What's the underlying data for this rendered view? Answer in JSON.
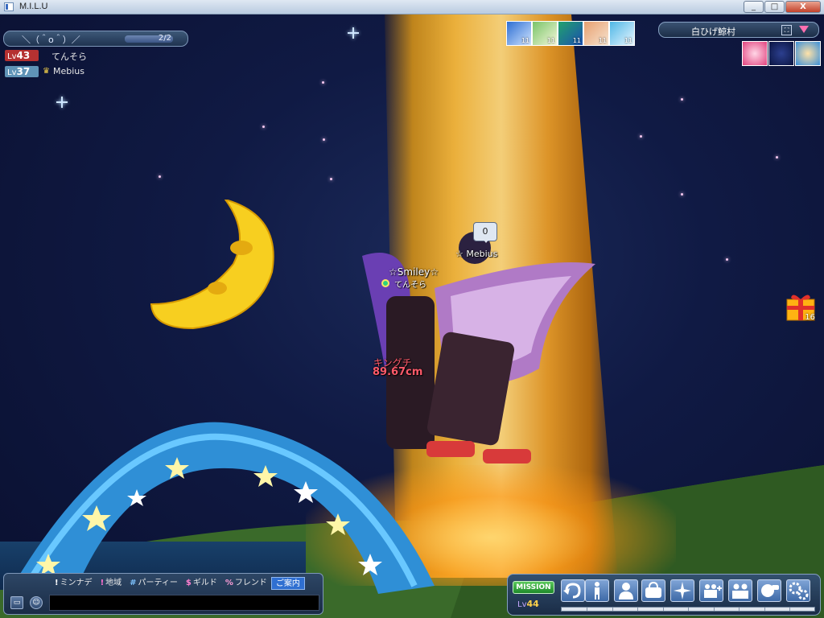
{
  "window": {
    "title": "M.I.L.U",
    "minimize": "_",
    "maximize": "□",
    "close": "X"
  },
  "party": {
    "emote": "＼（＾o＾）／",
    "count": "2/2",
    "members": [
      {
        "level_prefix": "Lv",
        "level": "43",
        "name": "てんそら",
        "color": "#b53131"
      },
      {
        "level_prefix": "Lv",
        "level": "37",
        "name": "Mebius",
        "color": "#5f93b7",
        "leader": true
      }
    ]
  },
  "location": {
    "name": "白ひげ鯨村"
  },
  "buffs": [
    {
      "icon": "eye-buff-icon",
      "timer": "11"
    },
    {
      "icon": "leaf-buff-icon",
      "timer": "11"
    },
    {
      "icon": "wave-buff-icon",
      "timer": "11"
    },
    {
      "icon": "face-buff-icon",
      "timer": "11"
    },
    {
      "icon": "sparkle-buff-icon",
      "timer": "11"
    }
  ],
  "map_icons": [
    "heart-event-icon",
    "moon-event-icon",
    "mascot-event-icon"
  ],
  "gift": {
    "count": "16"
  },
  "nameplates": {
    "title": "☆Smiley☆",
    "player": "てんそら",
    "partner": "Mebius",
    "bubble": "0",
    "catch_name": "キングチ",
    "catch_length": "89.67cm"
  },
  "chat": {
    "tabs": [
      {
        "sym": "!",
        "label": "ミンナデ"
      },
      {
        "sym": "!",
        "label": "地域"
      },
      {
        "sym": "#",
        "label": "パーティー"
      },
      {
        "sym": "$",
        "label": "ギルド"
      },
      {
        "sym": "%",
        "label": "フレンド"
      },
      {
        "sym": "",
        "label": "ご案内",
        "active": true
      }
    ],
    "input_value": ""
  },
  "menu": {
    "mission_label": "MISSION",
    "level_prefix": "Lv",
    "level": "44",
    "buttons": [
      "return-icon",
      "walk-icon",
      "character-icon",
      "bag-icon",
      "skill-icon",
      "party-add-icon",
      "friends-icon",
      "chat-bubble-icon",
      "settings-icon"
    ]
  },
  "colors": {
    "accent": "#2f6fd1",
    "beam": "#f6b73a",
    "sky": "#101a44"
  }
}
